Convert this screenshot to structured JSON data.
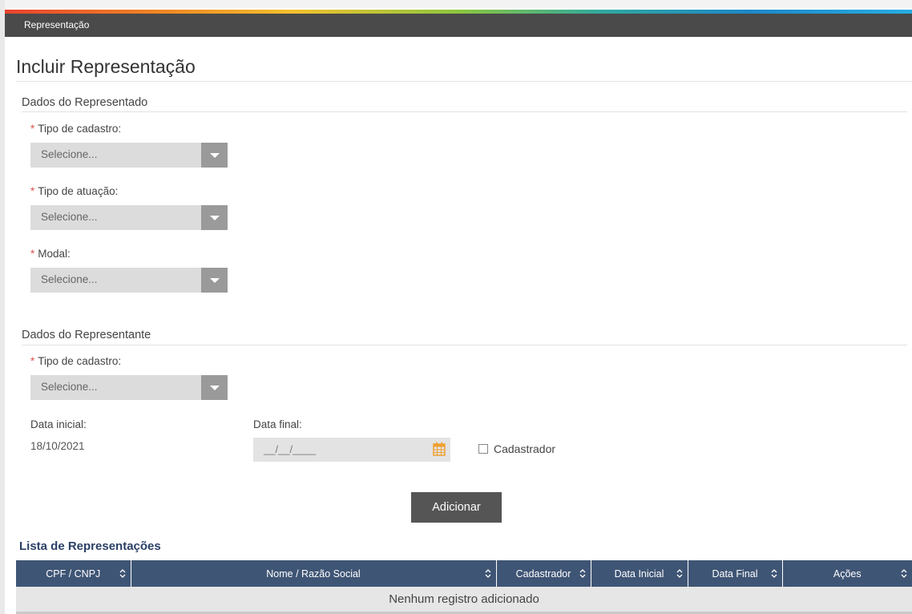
{
  "window": {
    "title": "Representação"
  },
  "page": {
    "title": "Incluir Representação"
  },
  "represented": {
    "section_title": "Dados do Representado",
    "fields": [
      {
        "label": "Tipo de cadastro:",
        "required_mark": "*",
        "value": "Selecione..."
      },
      {
        "label": "Tipo de atuação:",
        "required_mark": "*",
        "value": "Selecione..."
      },
      {
        "label": "Modal:",
        "required_mark": "*",
        "value": "Selecione..."
      }
    ]
  },
  "representative": {
    "section_title": "Dados do Representante",
    "tipo_cadastro": {
      "label": "Tipo de cadastro:",
      "required_mark": "*",
      "value": "Selecione..."
    },
    "start_date": {
      "label": "Data inicial:",
      "value": "18/10/2021"
    },
    "end_date": {
      "label": "Data final:",
      "placeholder": "__/__/____",
      "icon": "calendar-icon"
    },
    "registrar_checkbox": {
      "label": "Cadastrador",
      "checked": false
    }
  },
  "actions": {
    "add_label": "Adicionar"
  },
  "list": {
    "title": "Lista de Representações",
    "columns": [
      "CPF / CNPJ",
      "Nome / Razão Social",
      "Cadastrador",
      "Data Inicial",
      "Data Final",
      "Ações"
    ],
    "empty_message": "Nenhum registro adicionado"
  },
  "colors": {
    "title_bar": "#4a4a4a",
    "table_header": "#3f5575",
    "list_title": "#2b4066",
    "required": "#d9534f",
    "calendar_icon": "#f0a030"
  }
}
